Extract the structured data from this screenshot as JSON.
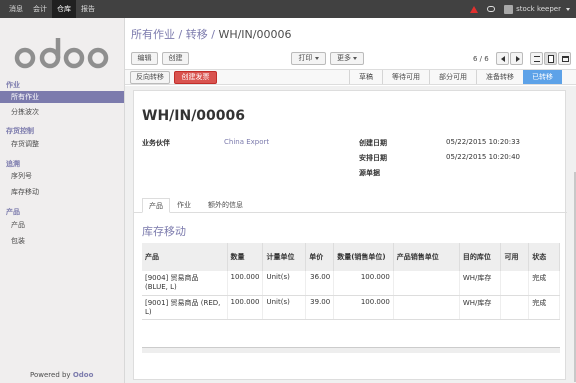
{
  "topbar": {
    "menu": [
      "消息",
      "会计",
      "仓库",
      "报告"
    ],
    "active_index": 2,
    "user": "stock keeper"
  },
  "sidebar": {
    "logo": "odoo",
    "sections": [
      {
        "title": "作业",
        "items": [
          "所有作业",
          "分拣波次"
        ]
      },
      {
        "title": "存货控制",
        "items": [
          "存货调整"
        ]
      },
      {
        "title": "追溯",
        "items": [
          "序列号",
          "库存移动"
        ]
      },
      {
        "title": "产品",
        "items": [
          "产品",
          "包装"
        ]
      }
    ],
    "active_item": "所有作业",
    "powered_prefix": "Powered by",
    "powered_brand": "Odoo"
  },
  "breadcrumb": {
    "items": [
      "所有作业",
      "转移"
    ],
    "sep": "/",
    "current": "WH/IN/00006"
  },
  "toolbar": {
    "edit": "编辑",
    "create": "创建",
    "print": "打印",
    "more": "更多",
    "pager": "6 / 6"
  },
  "statusbar": {
    "reverse": "反向转移",
    "create_invoice": "创建发票",
    "stages": [
      "草稿",
      "等待可用",
      "部分可用",
      "准备转移",
      "已转移"
    ],
    "active_stage": "已转移"
  },
  "form": {
    "name": "WH/IN/00006",
    "partner_label": "业务伙伴",
    "partner": "China Export",
    "create_date_label": "创建日期",
    "create_date": "05/22/2015 10:20:33",
    "scheduled_label": "安排日期",
    "scheduled": "05/22/2015 10:20:40",
    "origin_label": "源单据",
    "origin": ""
  },
  "tabs": [
    "产品",
    "作业",
    "额外的信息"
  ],
  "active_tab": "产品",
  "moves": {
    "title": "库存移动",
    "columns": [
      "产品",
      "数量",
      "计量单位",
      "单价",
      "数量(销售单位)",
      "产品销售单位",
      "目的库位",
      "可用",
      "状态"
    ],
    "rows": [
      {
        "product": "[9004] 贸易商品 (BLUE, L)",
        "qty": "100.000",
        "uom": "Unit(s)",
        "price": "36.00",
        "uos_qty": "100.000",
        "uos": "",
        "dest": "WH/库存",
        "avail": "",
        "state": "完成"
      },
      {
        "product": "[9001] 贸易商品 (RED, L)",
        "qty": "100.000",
        "uom": "Unit(s)",
        "price": "39.00",
        "uos_qty": "100.000",
        "uos": "",
        "dest": "WH/库存",
        "avail": "",
        "state": "完成"
      }
    ]
  },
  "colors": {
    "brand": "#7c7bad",
    "topbar": "#414141",
    "active_stage": "#5da2e8",
    "danger": "#d9534f"
  }
}
